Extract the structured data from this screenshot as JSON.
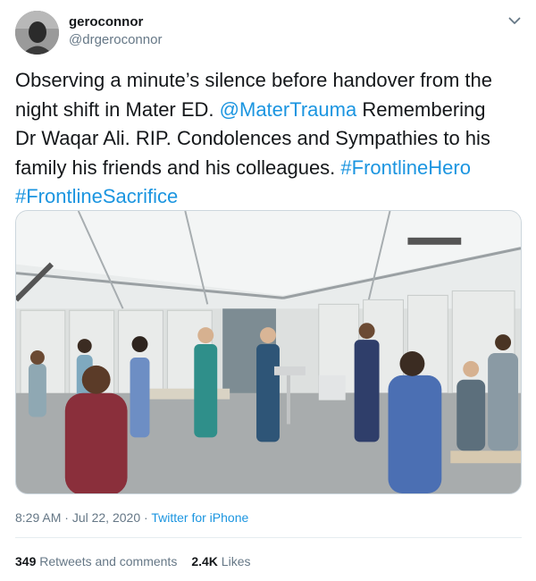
{
  "author": {
    "display_name": "geroconnor",
    "handle": "@drgeroconnor"
  },
  "tweet": {
    "line1": "Observing a minute’s silence before handover from the",
    "line2_pre": "night shift in Mater ED. ",
    "mention": "@MaterTrauma",
    "line2_post": " Remembering",
    "line3": "Dr Waqar Ali. RIP. Condolences and Sympathies to his",
    "line4_pre": "family his friends and his colleagues. ",
    "hashtag1": "#FrontlineHero",
    "hashtag2": "#FrontlineSacrifice"
  },
  "meta": {
    "time": "8:29 AM",
    "separator1": " · ",
    "date": "Jul 22, 2020",
    "separator2": " · ",
    "source": "Twitter for iPhone"
  },
  "stats": {
    "retweets_count": "349",
    "retweets_label": " Retweets and comments",
    "likes_count": "2.4K",
    "likes_label": " Likes"
  },
  "icons": {
    "menu": "chevron-down-icon"
  },
  "colors": {
    "link": "#1b95e0",
    "secondary_text": "#657786",
    "primary_text": "#14171a"
  }
}
